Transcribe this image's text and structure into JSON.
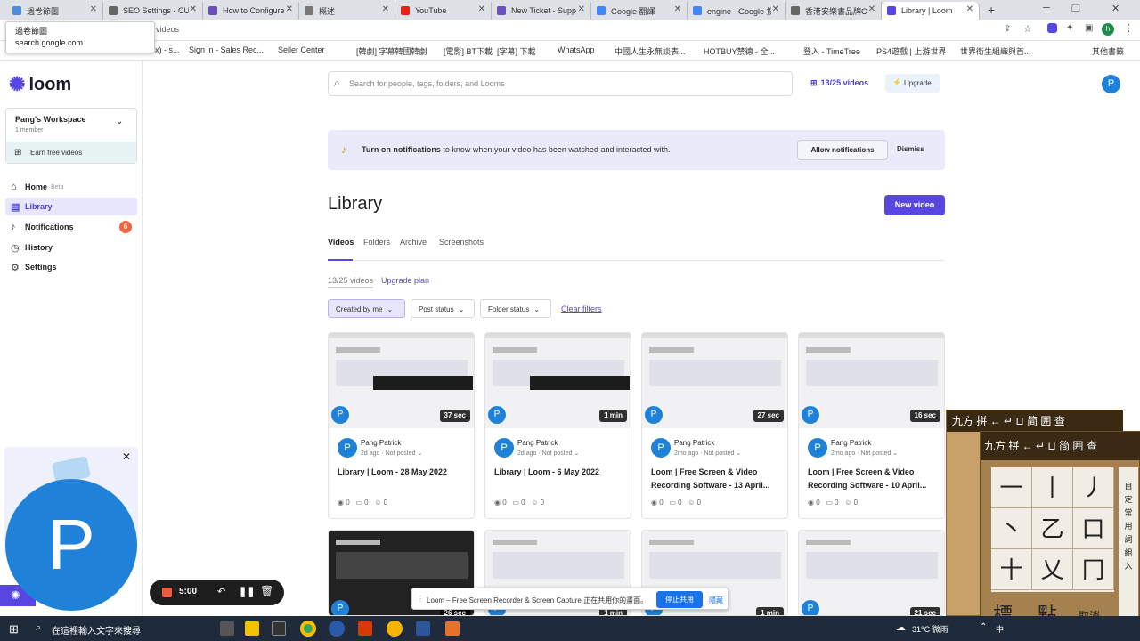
{
  "browser": {
    "tabs": [
      {
        "label": "過卷節圖",
        "color": "#4f8bd8"
      },
      {
        "label": "SEO Settings ‹ CU",
        "color": "#666"
      },
      {
        "label": "How to Configure",
        "color": "#6b4fbb"
      },
      {
        "label": "概述",
        "color": "#777"
      },
      {
        "label": "YouTube",
        "color": "#e62117"
      },
      {
        "label": "New Ticket - Supp",
        "color": "#6b4fbb"
      },
      {
        "label": "Google 翻譯",
        "color": "#4285f4"
      },
      {
        "label": "engine - Google 搜",
        "color": "#4285f4"
      },
      {
        "label": "香港安樂書品牌CU",
        "color": "#666"
      },
      {
        "label": "Library | Loom",
        "color": "#5746e0"
      }
    ],
    "new_tab": "+",
    "address_partial": "videos",
    "tooltip": {
      "title": "過卷節圖",
      "url": "search.google.com"
    },
    "bookmarks": [
      "x) - s...",
      "Sign in - Sales Rec...",
      "Seller Center",
      "[韓劇] 字幕韓國韓劇",
      "[電影] BT下載",
      "[字幕] 下載",
      "WhatsApp",
      "中國人生永無談表...",
      "HOTBUY禁德 - 全...",
      "登入 - TimeTree",
      "PS4遊戲 | 上游世界",
      "世界衛生組織與首...",
      "其他書籤"
    ]
  },
  "sidebar": {
    "logo": "loom",
    "workspace_name": "Pang's Workspace",
    "workspace_members": "1 member",
    "earn": "Earn free videos",
    "nav": [
      {
        "label": "Home",
        "suffix": "Beta",
        "icon": "home-icon"
      },
      {
        "label": "Library",
        "icon": "library-icon"
      },
      {
        "label": "Notifications",
        "icon": "bell-icon",
        "badge": "6"
      },
      {
        "label": "History",
        "icon": "clock-icon"
      },
      {
        "label": "Settings",
        "icon": "gear-icon"
      }
    ]
  },
  "header": {
    "search_placeholder": "Search for people, tags, folders, and Looms",
    "quota": "13/25 videos",
    "upgrade": "Upgrade",
    "avatar": "P"
  },
  "banner": {
    "bold": "Turn on notifications",
    "text": " to know when your video has been watched and interacted with.",
    "allow": "Allow notifications",
    "dismiss": "Dismiss"
  },
  "library": {
    "title": "Library",
    "new_video": "New video",
    "tabs": [
      "Videos",
      "Folders",
      "Archive",
      "Screenshots"
    ],
    "count": "13/25 videos",
    "upgrade_plan": "Upgrade plan",
    "filters": [
      "Created by me",
      "Post status",
      "Folder status"
    ],
    "clear_filters": "Clear filters"
  },
  "videos": [
    {
      "duration": "37 sec",
      "owner": "Pang Patrick",
      "meta": "2d ago · Not posted",
      "title": "Library | Loom - 28 May 2022",
      "views": "0",
      "comments": "0",
      "reactions": "0"
    },
    {
      "duration": "1 min",
      "owner": "Pang Patrick",
      "meta": "2d ago · Not posted",
      "title": "Library | Loom - 6 May 2022",
      "views": "0",
      "comments": "0",
      "reactions": "0"
    },
    {
      "duration": "27 sec",
      "owner": "Pang Patrick",
      "meta": "2mo ago · Not posted",
      "title": "Loom | Free Screen & Video Recording Software - 13 April...",
      "views": "0",
      "comments": "0",
      "reactions": "0"
    },
    {
      "duration": "16 sec",
      "owner": "Pang Patrick",
      "meta": "2mo ago · Not posted",
      "title": "Loom | Free Screen & Video Recording Software - 10 April...",
      "views": "0",
      "comments": "0",
      "reactions": "0"
    }
  ],
  "second_row_durations": [
    "26 sec",
    "1 min",
    "1 min",
    "21 sec"
  ],
  "recorder": {
    "time": "5:00",
    "avatar": "P"
  },
  "share_bar": {
    "text": "Loom – Free Screen Recorder & Screen Capture 正在共用你的畫面。",
    "stop": "停止共用",
    "hide": "隱藏"
  },
  "ime": {
    "top_row": "九方 拼 ← ↵ ⊔ 简 囲 查",
    "keys": [
      "一",
      "丨",
      "丿",
      "丶",
      "乙",
      "口",
      "十",
      "乂",
      "冂"
    ],
    "bottom": [
      "標",
      "點",
      "取消"
    ],
    "side": [
      "自",
      "定",
      "常",
      "用",
      "詞",
      "組",
      "入"
    ]
  },
  "taskbar": {
    "search": "在這裡輸入文字來搜尋",
    "weather": "31°C 微雨",
    "lang": "中"
  }
}
